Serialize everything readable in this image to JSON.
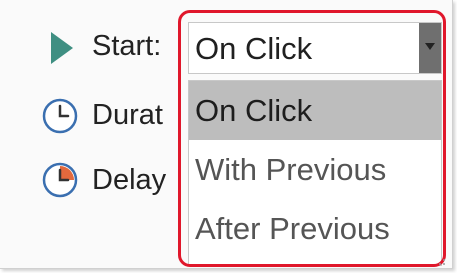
{
  "rows": {
    "start_label": "Start:",
    "duration_label": "Durat",
    "delay_label": "Delay"
  },
  "start_select": {
    "value": "On Click",
    "options": [
      "On Click",
      "With Previous",
      "After Previous"
    ],
    "selected_index": 0
  },
  "icons": {
    "start": "play-triangle-icon",
    "duration": "clock-icon",
    "delay": "delay-clock-icon",
    "arrow": "dropdown-arrow-icon"
  },
  "colors": {
    "play_icon": "#3f8f82",
    "clock_outline": "#3a6fb0",
    "delay_fill": "#e2693d",
    "highlight": "#e0172b",
    "selected_option": "#bdbdbd"
  }
}
